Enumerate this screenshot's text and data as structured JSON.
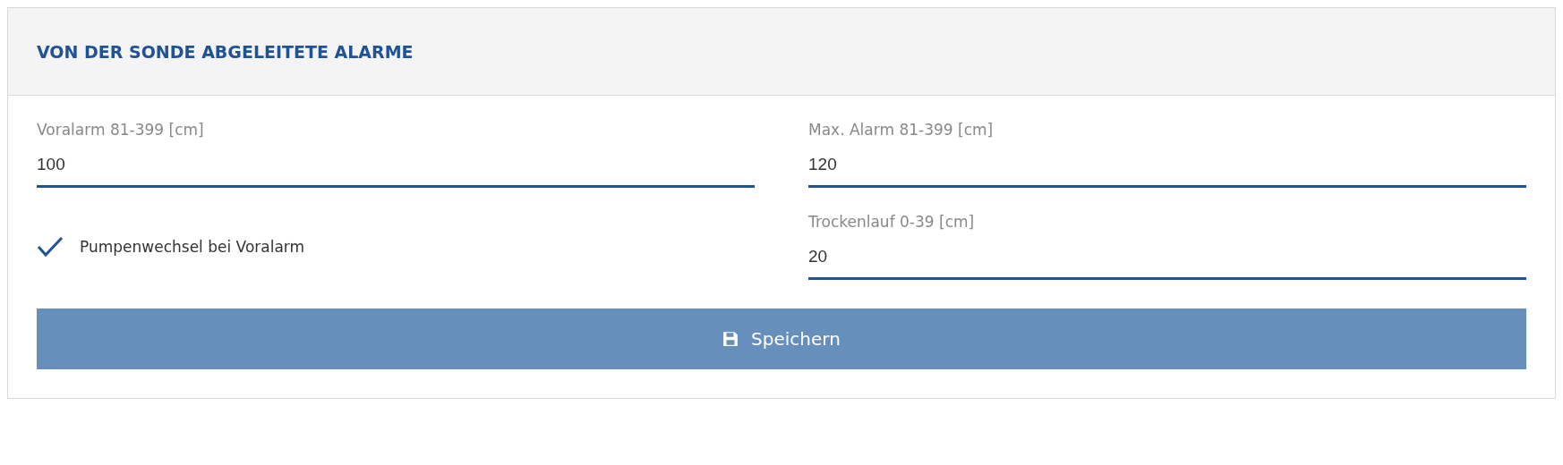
{
  "panel": {
    "title": "VON DER SONDE ABGELEITETE ALARME"
  },
  "items": [
    {
      "kind": "field",
      "label": "Voralarm 81-399 [cm]",
      "value": "100"
    },
    {
      "kind": "field",
      "label": "Max. Alarm 81-399 [cm]",
      "value": "120"
    },
    {
      "kind": "checkbox",
      "label": "Pumpenwechsel bei Voralarm",
      "checked": true
    },
    {
      "kind": "field",
      "label": "Trockenlauf 0-39 [cm]",
      "value": "20"
    }
  ],
  "save_button": {
    "label": "Speichern"
  }
}
